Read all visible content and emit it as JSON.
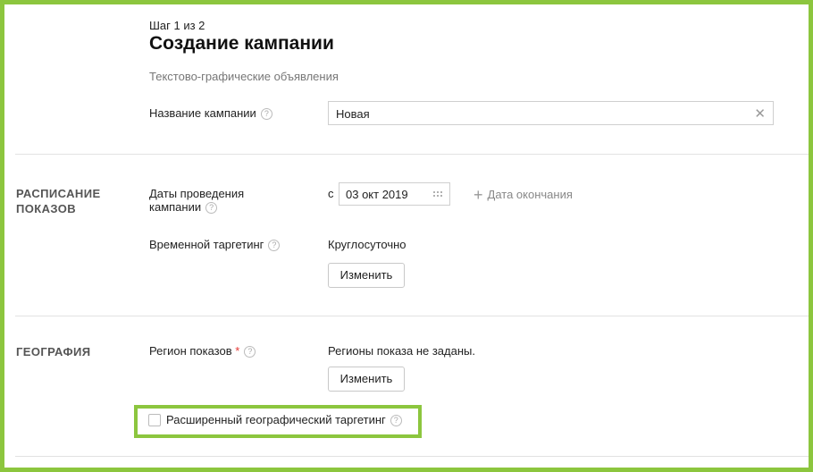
{
  "header": {
    "step": "Шаг 1 из 2",
    "title": "Создание кампании",
    "subtitle": "Текстово-графические объявления"
  },
  "campaign_name": {
    "label": "Название кампании",
    "value": "Новая"
  },
  "schedule": {
    "section_title": "РАСПИСАНИЕ\nПОКАЗОВ",
    "dates_label": "Даты проведения кампании",
    "from_prefix": "с",
    "start_date": "03 окт 2019",
    "add_end_label": "Дата окончания",
    "time_targeting_label": "Временной таргетинг",
    "time_targeting_value": "Круглосуточно",
    "change_button": "Изменить"
  },
  "geography": {
    "section_title": "ГЕОГРАФИЯ",
    "region_label": "Регион показов",
    "required_mark": "*",
    "region_value": "Регионы показа не заданы.",
    "change_button": "Изменить",
    "extended_targeting_label": "Расширенный географический таргетинг",
    "extended_targeting_checked": false
  },
  "icons": {
    "help": "question-circle-icon",
    "clear": "close-icon",
    "calendar": "calendar-icon",
    "add": "plus-icon"
  },
  "colors": {
    "highlight": "#8cc63e",
    "required": "#e53935"
  }
}
